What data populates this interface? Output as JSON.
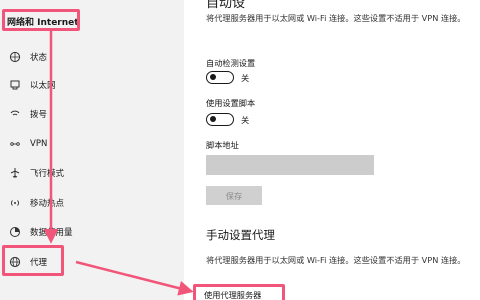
{
  "sidebar": {
    "section_title": "网络和 Internet",
    "items": [
      {
        "label": "状态",
        "icon": "globe-status-icon"
      },
      {
        "label": "以太网",
        "icon": "ethernet-icon"
      },
      {
        "label": "拨号",
        "icon": "dialup-icon"
      },
      {
        "label": "VPN",
        "icon": "vpn-icon"
      },
      {
        "label": "飞行模式",
        "icon": "airplane-icon"
      },
      {
        "label": "移动热点",
        "icon": "hotspot-icon"
      },
      {
        "label": "数据使用量",
        "icon": "data-usage-icon"
      },
      {
        "label": "代理",
        "icon": "proxy-globe-icon"
      }
    ]
  },
  "main": {
    "auto_section": {
      "description": "将代理服务器用于以太网或 Wi-Fi 连接。这些设置不适用于 VPN 连接。",
      "auto_detect_label": "自动检测设置",
      "auto_detect_state": "关",
      "use_script_label": "使用设置脚本",
      "use_script_state": "关",
      "script_address_label": "脚本地址",
      "script_address_value": "",
      "save_label": "保存"
    },
    "manual_section": {
      "heading": "手动设置代理",
      "description": "将代理服务器用于以太网或 Wi-Fi 连接。这些设置不适用于 VPN 连接。",
      "use_proxy_label": "使用代理服务器"
    }
  },
  "annotation_color": "#f2557a"
}
